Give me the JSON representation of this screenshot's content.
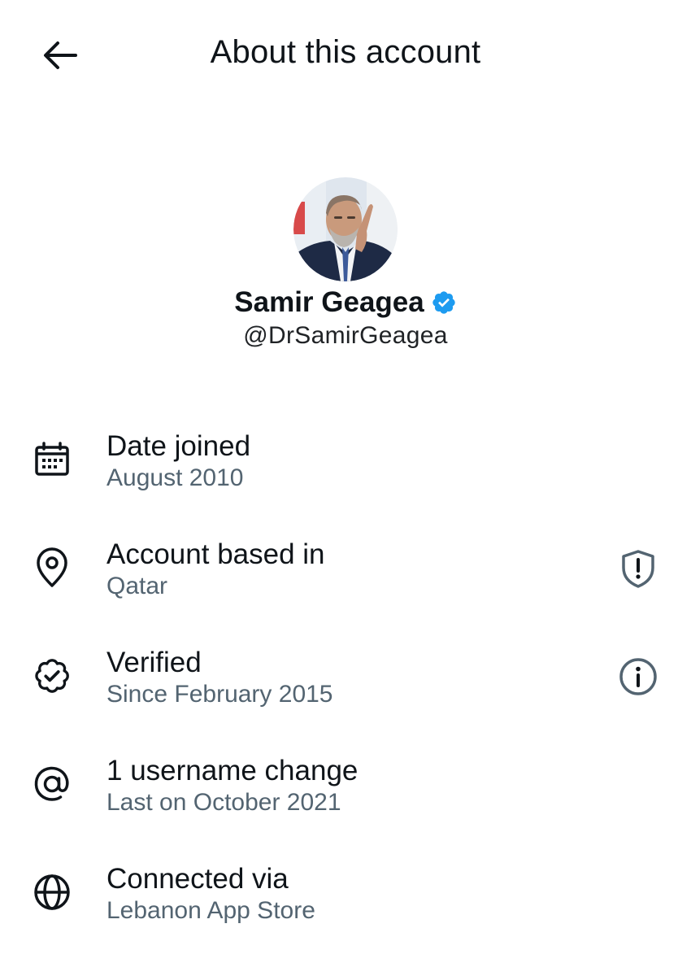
{
  "header": {
    "back_icon": "arrow-left-icon",
    "title": "About this account"
  },
  "profile": {
    "avatar_icon": "profile-photo",
    "display_name": "Samir Geagea",
    "verified_badge_icon": "verified-badge-icon",
    "verified_color": "#1d9bf0",
    "handle": "@DrSamirGeagea"
  },
  "details": {
    "date_joined": {
      "icon": "calendar-icon",
      "title": "Date joined",
      "value": "August 2010"
    },
    "account_based_in": {
      "icon": "location-pin-icon",
      "title": "Account based in",
      "value": "Qatar",
      "action_icon": "shield-alert-icon"
    },
    "verified": {
      "icon": "verified-outline-icon",
      "title": "Verified",
      "value": "Since February 2015",
      "action_icon": "info-icon"
    },
    "username_change": {
      "icon": "at-sign-icon",
      "title": "1 username change",
      "value": "Last on October 2021"
    },
    "connected_via": {
      "icon": "globe-icon",
      "title": "Connected via",
      "value": "Lebanon App Store"
    }
  },
  "colors": {
    "text_primary": "#0f1419",
    "text_secondary": "#536471",
    "background": "#ffffff"
  }
}
